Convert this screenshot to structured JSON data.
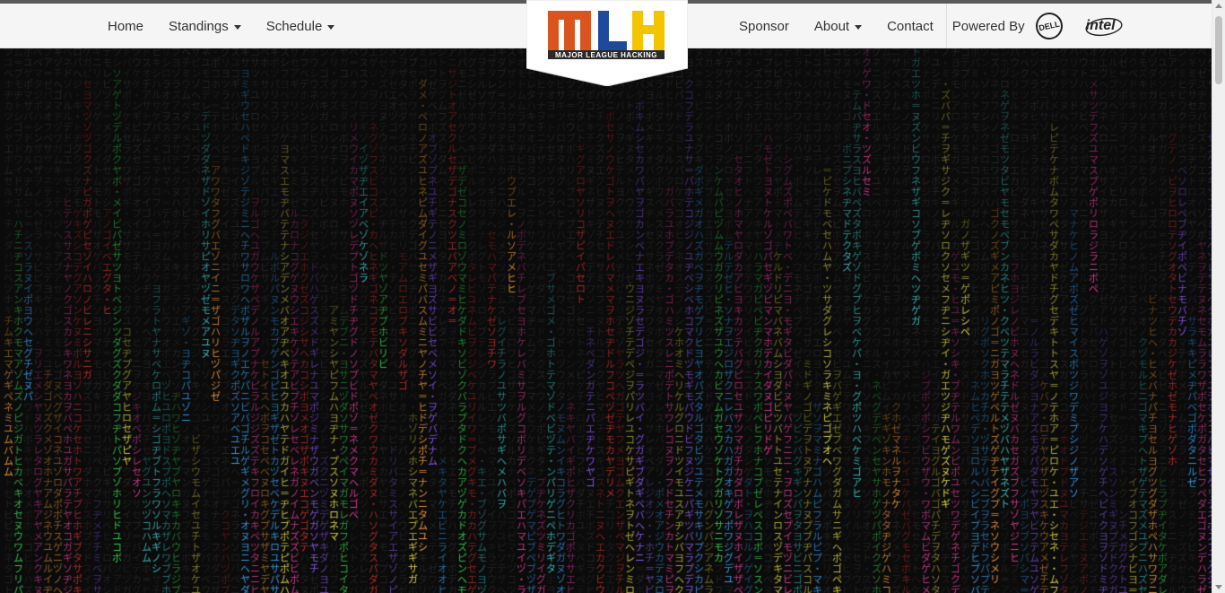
{
  "nav": {
    "left": [
      {
        "label": "Home",
        "dropdown": false
      },
      {
        "label": "Standings",
        "dropdown": true
      },
      {
        "label": "Schedule",
        "dropdown": true
      }
    ],
    "right": [
      {
        "label": "Sponsor",
        "dropdown": false
      },
      {
        "label": "About",
        "dropdown": true
      },
      {
        "label": "Contact",
        "dropdown": false
      }
    ],
    "powered_by": "Powered By",
    "sponsors": [
      {
        "name": "DELL",
        "icon": "dell-logo-icon"
      },
      {
        "name": "intel",
        "icon": "intel-logo-icon"
      }
    ]
  },
  "logo": {
    "letters": "MLH",
    "subtitle": "MAJOR LEAGUE HACKING",
    "colors": {
      "m": "#d9541e",
      "l": "#1f4a9c",
      "h": "#f3c500",
      "band": "#2a2a2a"
    }
  },
  "background": {
    "glyphs": "アイウエオカキクケコサシスセソタチツテトナニヌネノハヒフヘホマミムメモヤユヨラリルレロワヲンガギグゲゴザジズゼゾダヂヅデドバビブベボパピプペポ・＝",
    "colors": [
      "#39d353",
      "#e0409a",
      "#8e5cf0",
      "#f3a03b",
      "#3aa0f0",
      "#e8e24a",
      "#c03030",
      "#40c0c0"
    ]
  }
}
